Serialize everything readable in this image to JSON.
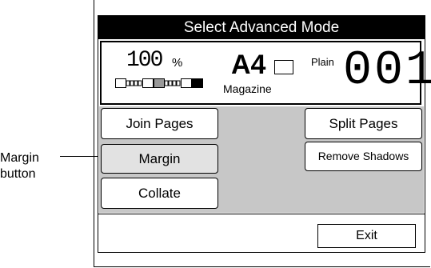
{
  "callout": {
    "line1": "Margin",
    "line2": "button"
  },
  "title": "Select Advanced Mode",
  "status": {
    "zoom_value": "100",
    "zoom_unit": "%",
    "paper_size": "A4",
    "paper_type": "Plain",
    "original_type": "Magazine",
    "copy_count": "001"
  },
  "buttons": {
    "join_pages": "Join Pages",
    "split_pages": "Split Pages",
    "margin": "Margin",
    "remove_shadows": "Remove Shadows",
    "collate": "Collate",
    "exit": "Exit"
  }
}
